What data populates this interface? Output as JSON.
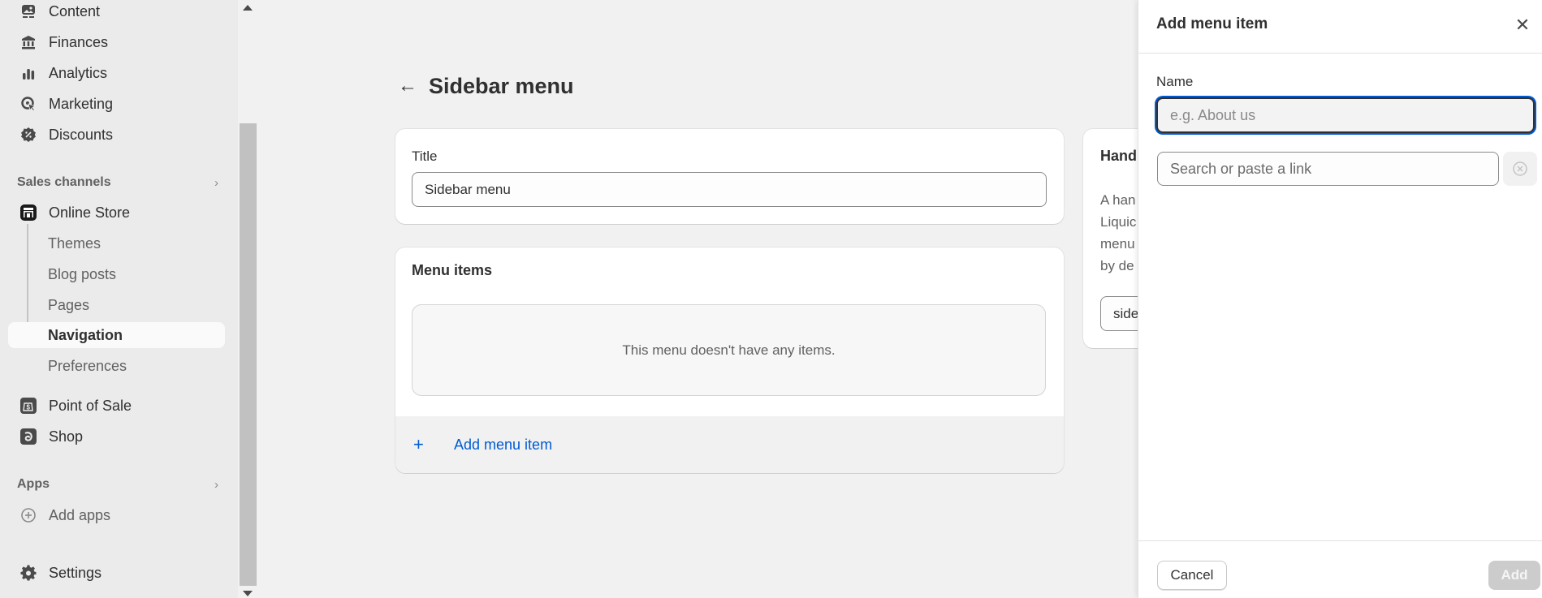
{
  "sidebar": {
    "items": [
      {
        "label": "Content",
        "icon": "content-icon"
      },
      {
        "label": "Finances",
        "icon": "bank-icon"
      },
      {
        "label": "Analytics",
        "icon": "bar-chart-icon"
      },
      {
        "label": "Marketing",
        "icon": "target-icon"
      },
      {
        "label": "Discounts",
        "icon": "discount-badge-icon"
      }
    ],
    "sales_channels": {
      "heading": "Sales channels",
      "online_store": {
        "label": "Online Store",
        "icon": "store-icon"
      },
      "sub_items": [
        {
          "label": "Themes",
          "active": false
        },
        {
          "label": "Blog posts",
          "active": false
        },
        {
          "label": "Pages",
          "active": false
        },
        {
          "label": "Navigation",
          "active": true
        },
        {
          "label": "Preferences",
          "active": false
        }
      ],
      "other": [
        {
          "label": "Point of Sale",
          "icon": "pos-icon"
        },
        {
          "label": "Shop",
          "icon": "shop-icon"
        }
      ]
    },
    "apps": {
      "heading": "Apps",
      "add_apps": "Add apps"
    },
    "settings": "Settings"
  },
  "main": {
    "page_title": "Sidebar menu",
    "title_card": {
      "label": "Title",
      "value": "Sidebar menu"
    },
    "menu_card": {
      "heading": "Menu items",
      "empty_text": "This menu doesn't have any items.",
      "add_label": "Add menu item",
      "add_icon": "+"
    },
    "handle_card": {
      "heading": "Hand",
      "text_lines": [
        "A han",
        "Liquic",
        "menu",
        "by de"
      ],
      "input_value": "side"
    }
  },
  "drawer": {
    "title": "Add menu item",
    "name_label": "Name",
    "name_placeholder": "e.g. About us",
    "link_placeholder": "Search or paste a link",
    "cancel_label": "Cancel",
    "add_label": "Add",
    "accent_color": "#005bd3"
  }
}
